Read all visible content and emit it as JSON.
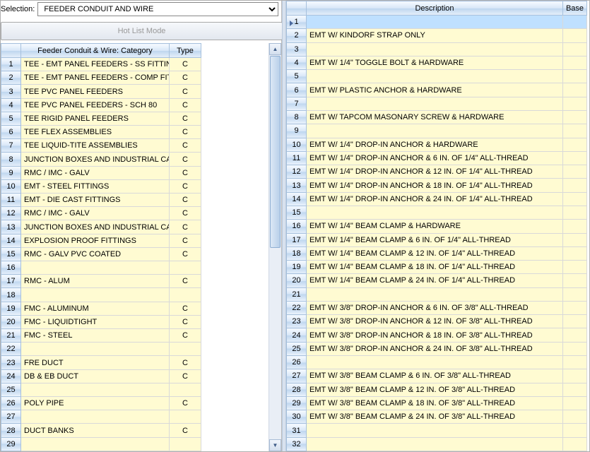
{
  "selection_label": "Selection:",
  "selection_value": "FEEDER CONDUIT AND WIRE",
  "hot_list_btn": "Hot List Mode",
  "left": {
    "header_left": "Feeder Conduit & Wire: Category",
    "header_right": "Type",
    "rows": [
      {
        "n": 1,
        "cat": "TEE - EMT PANEL FEEDERS - SS FITTINGS",
        "t": "C"
      },
      {
        "n": 2,
        "cat": "TEE - EMT PANEL FEEDERS - COMP FITTING",
        "t": "C"
      },
      {
        "n": 3,
        "cat": "TEE PVC PANEL FEEDERS",
        "t": "C"
      },
      {
        "n": 4,
        "cat": "TEE PVC PANEL FEEDERS - SCH 80",
        "t": "C"
      },
      {
        "n": 5,
        "cat": "TEE RIGID PANEL FEEDERS",
        "t": "C"
      },
      {
        "n": 6,
        "cat": "TEE FLEX ASSEMBLIES",
        "t": "C"
      },
      {
        "n": 7,
        "cat": "TEE LIQUID-TITE ASSEMBLIES",
        "t": "C"
      },
      {
        "n": 8,
        "cat": "JUNCTION BOXES AND INDUSTRIAL CABIN",
        "t": "C"
      },
      {
        "n": 9,
        "cat": "RMC / IMC - GALV",
        "t": "C"
      },
      {
        "n": 10,
        "cat": "EMT - STEEL FITTINGS",
        "t": "C"
      },
      {
        "n": 11,
        "cat": "EMT - DIE CAST FITTINGS",
        "t": "C"
      },
      {
        "n": 12,
        "cat": "RMC / IMC - GALV",
        "t": "C"
      },
      {
        "n": 13,
        "cat": "JUNCTION BOXES AND INDUSTRIAL CABIN",
        "t": "C"
      },
      {
        "n": 14,
        "cat": "EXPLOSION PROOF FITTINGS",
        "t": "C"
      },
      {
        "n": 15,
        "cat": "RMC - GALV PVC COATED",
        "t": "C"
      },
      {
        "n": 16,
        "cat": "",
        "t": ""
      },
      {
        "n": 17,
        "cat": "RMC - ALUM",
        "t": "C"
      },
      {
        "n": 18,
        "cat": "",
        "t": ""
      },
      {
        "n": 19,
        "cat": "FMC - ALUMINUM",
        "t": "C"
      },
      {
        "n": 20,
        "cat": "FMC - LIQUIDTIGHT",
        "t": "C"
      },
      {
        "n": 21,
        "cat": "FMC - STEEL",
        "t": "C"
      },
      {
        "n": 22,
        "cat": "",
        "t": ""
      },
      {
        "n": 23,
        "cat": "FRE DUCT",
        "t": "C"
      },
      {
        "n": 24,
        "cat": "DB & EB DUCT",
        "t": "C"
      },
      {
        "n": 25,
        "cat": "",
        "t": ""
      },
      {
        "n": 26,
        "cat": "POLY PIPE",
        "t": "C"
      },
      {
        "n": 27,
        "cat": "",
        "t": ""
      },
      {
        "n": 28,
        "cat": "DUCT BANKS",
        "t": "C"
      },
      {
        "n": 29,
        "cat": "",
        "t": ""
      }
    ]
  },
  "right": {
    "header_desc": "Description",
    "header_base": "Base",
    "rows": [
      {
        "n": 1,
        "d": "",
        "sel": true
      },
      {
        "n": 2,
        "d": "EMT W/ KINDORF STRAP ONLY"
      },
      {
        "n": 3,
        "d": ""
      },
      {
        "n": 4,
        "d": "EMT W/ 1/4\" TOGGLE BOLT & HARDWARE"
      },
      {
        "n": 5,
        "d": ""
      },
      {
        "n": 6,
        "d": "EMT W/ PLASTIC ANCHOR & HARDWARE"
      },
      {
        "n": 7,
        "d": ""
      },
      {
        "n": 8,
        "d": "EMT W/ TAPCOM MASONARY SCREW & HARDWARE"
      },
      {
        "n": 9,
        "d": ""
      },
      {
        "n": 10,
        "d": "EMT W/ 1/4\" DROP-IN ANCHOR & HARDWARE"
      },
      {
        "n": 11,
        "d": "EMT W/ 1/4\" DROP-IN ANCHOR & 6 IN. OF 1/4\" ALL-THREAD"
      },
      {
        "n": 12,
        "d": "EMT W/ 1/4\" DROP-IN ANCHOR & 12 IN. OF 1/4\" ALL-THREAD"
      },
      {
        "n": 13,
        "d": "EMT W/ 1/4\" DROP-IN ANCHOR & 18 IN. OF 1/4\" ALL-THREAD"
      },
      {
        "n": 14,
        "d": "EMT W/ 1/4\" DROP-IN ANCHOR & 24 IN. OF 1/4\" ALL-THREAD"
      },
      {
        "n": 15,
        "d": ""
      },
      {
        "n": 16,
        "d": "EMT W/ 1/4\" BEAM CLAMP & HARDWARE"
      },
      {
        "n": 17,
        "d": "EMT W/ 1/4\" BEAM CLAMP & 6 IN. OF 1/4\" ALL-THREAD"
      },
      {
        "n": 18,
        "d": "EMT W/ 1/4\" BEAM CLAMP & 12 IN. OF 1/4\" ALL-THREAD"
      },
      {
        "n": 19,
        "d": "EMT W/ 1/4\" BEAM CLAMP & 18 IN. OF 1/4\" ALL-THREAD"
      },
      {
        "n": 20,
        "d": "EMT W/ 1/4\" BEAM CLAMP & 24 IN. OF 1/4\" ALL-THREAD"
      },
      {
        "n": 21,
        "d": ""
      },
      {
        "n": 22,
        "d": "EMT W/ 3/8\" DROP-IN ANCHOR & 6 IN. OF 3/8\" ALL-THREAD"
      },
      {
        "n": 23,
        "d": "EMT W/ 3/8\" DROP-IN ANCHOR & 12 IN. OF 3/8\" ALL-THREAD"
      },
      {
        "n": 24,
        "d": "EMT W/ 3/8\" DROP-IN ANCHOR & 18 IN. OF 3/8\" ALL-THREAD"
      },
      {
        "n": 25,
        "d": "EMT W/ 3/8\" DROP-IN ANCHOR & 24 IN. OF 3/8\" ALL-THREAD"
      },
      {
        "n": 26,
        "d": ""
      },
      {
        "n": 27,
        "d": "EMT W/ 3/8\" BEAM CLAMP & 6 IN. OF 3/8\" ALL-THREAD"
      },
      {
        "n": 28,
        "d": "EMT W/ 3/8\" BEAM CLAMP & 12 IN. OF 3/8\" ALL-THREAD"
      },
      {
        "n": 29,
        "d": "EMT W/ 3/8\" BEAM CLAMP & 18 IN. OF 3/8\" ALL-THREAD"
      },
      {
        "n": 30,
        "d": "EMT W/ 3/8\" BEAM CLAMP & 24 IN. OF 3/8\" ALL-THREAD"
      },
      {
        "n": 31,
        "d": ""
      },
      {
        "n": 32,
        "d": ""
      }
    ]
  }
}
